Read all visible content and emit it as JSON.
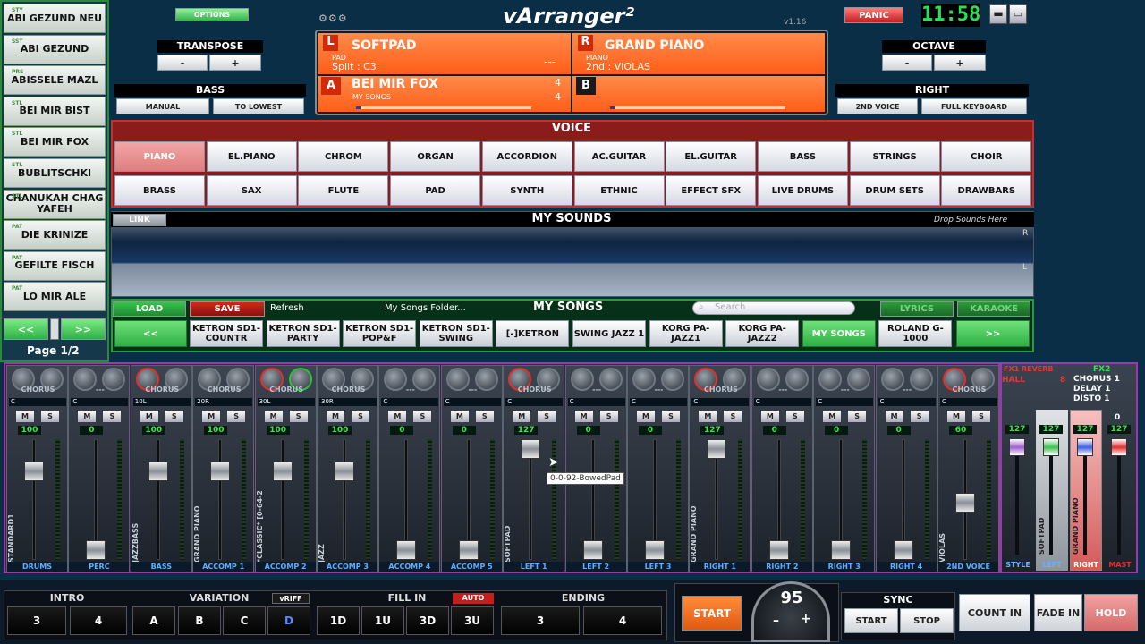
{
  "left_panel": {
    "songs": [
      {
        "tag": "STY",
        "name": "ABI GEZUND NEU"
      },
      {
        "tag": "SST",
        "name": "ABI GEZUND"
      },
      {
        "tag": "PRS",
        "name": "ABISSELE MAZL"
      },
      {
        "tag": "STL",
        "name": "BEI MIR BIST"
      },
      {
        "tag": "STL",
        "name": "BEI MIR FOX"
      },
      {
        "tag": "STL",
        "name": "BUBLITSCHKI"
      },
      {
        "tag": "STL",
        "name": "CHANUKAH CHAG YAFEH"
      },
      {
        "tag": "PAT",
        "name": "DIE KRINIZE"
      },
      {
        "tag": "PAT",
        "name": "GEFILTE FISCH"
      },
      {
        "tag": "PAT",
        "name": "LO MIR ALE"
      }
    ],
    "prev": "<<",
    "next": ">>",
    "page": "Page 1/2"
  },
  "top": {
    "options": "OPTIONS",
    "logo": "vArranger²",
    "version": "v1.16",
    "panic": "PANIC",
    "clock": "11:58",
    "transpose": {
      "label": "TRANSPOSE",
      "minus": "-",
      "plus": "+"
    },
    "bass": {
      "label": "BASS",
      "manual": "MANUAL",
      "lowest": "TO LOWEST"
    },
    "octave": {
      "label": "OCTAVE",
      "minus": "-",
      "plus": "+"
    },
    "right": {
      "label": "RIGHT",
      "second": "2ND VOICE",
      "full": "FULL KEYBOARD"
    }
  },
  "display": {
    "l_badge": "L",
    "l_name": "SOFTPAD",
    "l_cat": "PAD",
    "l_split": "Split : C3",
    "l_dash": "---",
    "r_badge": "R",
    "r_name": "GRAND PIANO",
    "r_cat": "PIANO",
    "r_second": "2nd : VIOLAS",
    "a_badge": "A",
    "a_name": "BEI MIR FOX",
    "a_sub": "MY SONGS",
    "a_num1": "4",
    "a_num2": "4",
    "b_badge": "B"
  },
  "voice": {
    "title": "VOICE",
    "row1": [
      "PIANO",
      "EL.PIANO",
      "CHROM",
      "ORGAN",
      "ACCORDION",
      "AC.GUITAR",
      "EL.GUITAR",
      "BASS",
      "STRINGS",
      "CHOIR"
    ],
    "row2": [
      "BRASS",
      "SAX",
      "FLUTE",
      "PAD",
      "SYNTH",
      "ETHNIC",
      "EFFECT SFX",
      "LIVE DRUMS",
      "DRUM SETS",
      "DRAWBARS"
    ]
  },
  "my_sounds": {
    "link": "LINK",
    "title": "MY SOUNDS",
    "drop": "Drop Sounds Here",
    "r": "R",
    "l": "L"
  },
  "my_songs": {
    "load": "LOAD",
    "save": "SAVE",
    "refresh": "Refresh",
    "folder": "My Songs Folder...",
    "title": "MY SONGS",
    "search_placeholder": "Search",
    "lyrics": "LYRICS",
    "karaoke": "KARAOKE",
    "prev": "<<",
    "next": ">>",
    "folders": [
      "KETRON SD1-COUNTR",
      "KETRON SD1-PARTY",
      "KETRON SD1-POP&F",
      "KETRON SD1-SWING",
      "[-]KETRON",
      "SWING JAZZ 1",
      "KORG PA-JAZZ1",
      "KORG PA-JAZZ2",
      "MY SONGS",
      "ROLAND G-1000"
    ]
  },
  "mixer": {
    "channels": [
      {
        "fx": "CHORUS",
        "pan": "C",
        "vol": "100",
        "inst": "STANDARD1",
        "name": "DRUMS",
        "level": 0.78
      },
      {
        "fx": "---",
        "pan": "C",
        "vol": "0",
        "inst": "",
        "name": "PERC",
        "level": 0.0
      },
      {
        "fx": "CHORUS",
        "pan": "10L",
        "vol": "100",
        "inst": "JAZZBASS",
        "name": "BASS",
        "level": 0.78
      },
      {
        "fx": "CHORUS",
        "pan": "20R",
        "vol": "100",
        "inst": "GRAND PIANO",
        "name": "ACCOMP 1",
        "level": 0.78
      },
      {
        "fx": "CHORUS",
        "pan": "30L",
        "vol": "100",
        "inst": "*CLASSIC* [0-64-24]",
        "name": "ACCOMP 2",
        "level": 0.78
      },
      {
        "fx": "CHORUS",
        "pan": "30R",
        "vol": "100",
        "inst": "JAZZ",
        "name": "ACCOMP 3",
        "level": 0.78
      },
      {
        "fx": "---",
        "pan": "C",
        "vol": "0",
        "inst": "",
        "name": "ACCOMP 4",
        "level": 0.0
      },
      {
        "fx": "---",
        "pan": "C",
        "vol": "0",
        "inst": "",
        "name": "ACCOMP 5",
        "level": 0.0
      },
      {
        "fx": "CHORUS",
        "pan": "C",
        "vol": "127",
        "inst": "SOFTPAD",
        "name": "LEFT 1",
        "level": 1.0
      },
      {
        "fx": "---",
        "pan": "C",
        "vol": "0",
        "inst": "",
        "name": "LEFT 2",
        "level": 0.0
      },
      {
        "fx": "---",
        "pan": "C",
        "vol": "0",
        "inst": "",
        "name": "LEFT 3",
        "level": 0.0
      },
      {
        "fx": "CHORUS",
        "pan": "C",
        "vol": "127",
        "inst": "GRAND PIANO",
        "name": "RIGHT 1",
        "level": 1.0
      },
      {
        "fx": "---",
        "pan": "C",
        "vol": "0",
        "inst": "",
        "name": "RIGHT 2",
        "level": 0.0
      },
      {
        "fx": "---",
        "pan": "C",
        "vol": "0",
        "inst": "",
        "name": "RIGHT 3",
        "level": 0.0
      },
      {
        "fx": "---",
        "pan": "C",
        "vol": "0",
        "inst": "",
        "name": "RIGHT 4",
        "level": 0.0
      },
      {
        "fx": "CHORUS",
        "pan": "C",
        "vol": "60",
        "inst": "VIOLAS",
        "name": "2ND VOICE",
        "level": 0.47
      }
    ],
    "tooltip": "0-0-92-BowedPad",
    "fx1_title": "FX1 REVERB",
    "fx1_value": "HALL",
    "fx1_num": "8",
    "fx2_title": "FX2",
    "fx2_list": [
      "CHORUS 1",
      "DELAY 1",
      "DISTO 1"
    ],
    "groups": [
      {
        "name": "STYLE",
        "vol": "127",
        "inst": ""
      },
      {
        "name": "LEFT",
        "vol": "127",
        "inst": "SOFTPAD"
      },
      {
        "name": "RIGHT",
        "vol": "127",
        "inst": "GRAND PIANO"
      },
      {
        "name": "MAST",
        "vol": "127",
        "inst": ""
      }
    ],
    "master_top": "0"
  },
  "bottom": {
    "intro": "INTRO",
    "intro_btns": [
      "3",
      "4"
    ],
    "variation": "VARIATION",
    "vriff": "vRIFF",
    "variation_btns": [
      "A",
      "B",
      "C",
      "D"
    ],
    "fill": "FILL IN",
    "auto": "AUTO",
    "fill_btns": [
      "1D",
      "1U",
      "3D",
      "3U"
    ],
    "ending": "ENDING",
    "ending_btns": [
      "3",
      "4"
    ],
    "start": "START",
    "tempo": "95",
    "tempo_minus": "–",
    "tempo_plus": "+",
    "sync": "SYNC",
    "sync_start": "START",
    "sync_stop": "STOP",
    "count_in": "COUNT IN",
    "fade_in": "FADE IN",
    "hold": "HOLD"
  }
}
